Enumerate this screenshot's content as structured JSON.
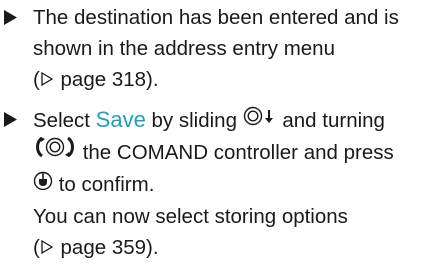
{
  "items": [
    {
      "line1": "The destination has been entered and is",
      "line2": "shown in the address entry menu",
      "ref_open": "(",
      "ref_text": " page 318).",
      "icons": [
        "bullet-triangle-icon",
        "page-reference-arrow-icon"
      ]
    },
    {
      "select_prefix": "Select ",
      "select_highlight": "Save",
      "select_mid": " by sliding ",
      "select_end": " and turning",
      "line2_rest": " the COMAND controller and press",
      "line3_rest": " to confirm.",
      "line4": "You can now select storing options",
      "ref_open": "(",
      "ref_text": " page 359).",
      "accent_color": "#1d9fc7",
      "icons": [
        "bullet-triangle-icon",
        "controller-slide-down-icon",
        "controller-turn-icon",
        "controller-press-icon",
        "page-reference-arrow-icon"
      ]
    }
  ]
}
